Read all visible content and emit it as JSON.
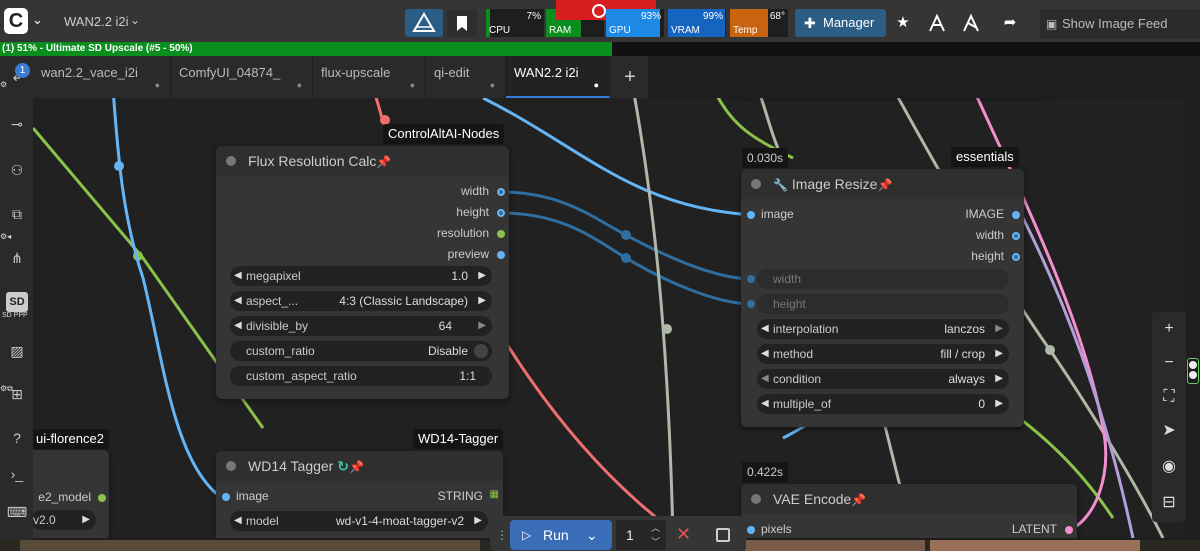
{
  "topbar": {
    "logo_letter": "C",
    "workflow_title": "WAN2.2 i2i",
    "monitors": {
      "cpu_label": "CPU",
      "cpu_pct": "7%",
      "cpu_value": 7,
      "ram_label": "RAM",
      "ram_value": 60,
      "gpu_label": "GPU",
      "gpu_pct": "93%",
      "gpu_value": 93,
      "vram_label": "VRAM",
      "vram_pct": "99%",
      "vram_value": 99,
      "temp_label": "Temp",
      "temp_value": "68°"
    },
    "manager_label": "Manager",
    "show_feed_label": "Show Image Feed"
  },
  "progress": {
    "label": "(1) 51% - Ultimate SD Upscale (#5 - 50%)",
    "overall_pct": 51,
    "node_pct": 50
  },
  "sidebar": {
    "queue_badge": "1",
    "sdppp_label": "SD PPP"
  },
  "tabs": [
    {
      "label": "wan2.2_vace_i2i",
      "active": false
    },
    {
      "label": "ComfyUI_04874_",
      "active": false
    },
    {
      "label": "flux-upscale",
      "active": false
    },
    {
      "label": "qi-edit",
      "active": false
    },
    {
      "label": "WAN2.2 i2i",
      "active": true
    }
  ],
  "nodes": {
    "flux": {
      "badge": "ControlAltAI-Nodes",
      "title": "Flux Resolution Calc",
      "outputs": [
        "width",
        "height",
        "resolution",
        "preview"
      ],
      "widgets": {
        "megapixel_label": "megapixel",
        "megapixel_value": "1.0",
        "aspect_label": "aspect_...",
        "aspect_value": "4:3 (Classic Landscape)",
        "divisible_label": "divisible_by",
        "divisible_value": "64",
        "custom_ratio_label": "custom_ratio",
        "custom_ratio_value": "Disable",
        "custom_aspect_label": "custom_aspect_ratio",
        "custom_aspect_value": "1:1"
      }
    },
    "resize": {
      "timing": "0.030s",
      "badge": "essentials",
      "title": "Image Resize",
      "input": "image",
      "outputs": [
        "IMAGE",
        "width",
        "height"
      ],
      "width_label": "width",
      "height_label": "height",
      "interp_label": "interpolation",
      "interp_value": "lanczos",
      "method_label": "method",
      "method_value": "fill / crop",
      "condition_label": "condition",
      "condition_value": "always",
      "multiple_label": "multiple_of",
      "multiple_value": "0"
    },
    "wd14": {
      "badge": "WD14-Tagger",
      "title": "WD14 Tagger",
      "input": "image",
      "output": "STRING",
      "model_label": "model",
      "model_value": "wd-v1-4-moat-tagger-v2"
    },
    "vae": {
      "timing": "0.422s",
      "title": "VAE Encode",
      "input": "pixels",
      "output": "LATENT"
    },
    "florence": {
      "badge": "ui-florence2",
      "slot": "e2_model",
      "value": "v2.0"
    }
  },
  "runbar": {
    "run_label": "Run",
    "count": "1"
  },
  "colors": {
    "image_link": "#64b5f6",
    "int_link": "#2f6e9e",
    "green_link": "#8bc34a",
    "red_link": "#ef6f6f",
    "gray_link": "#b0b8a8",
    "pink_link": "#f48fcf",
    "purple_link": "#b39ddb",
    "accent": "#2c5d85"
  }
}
